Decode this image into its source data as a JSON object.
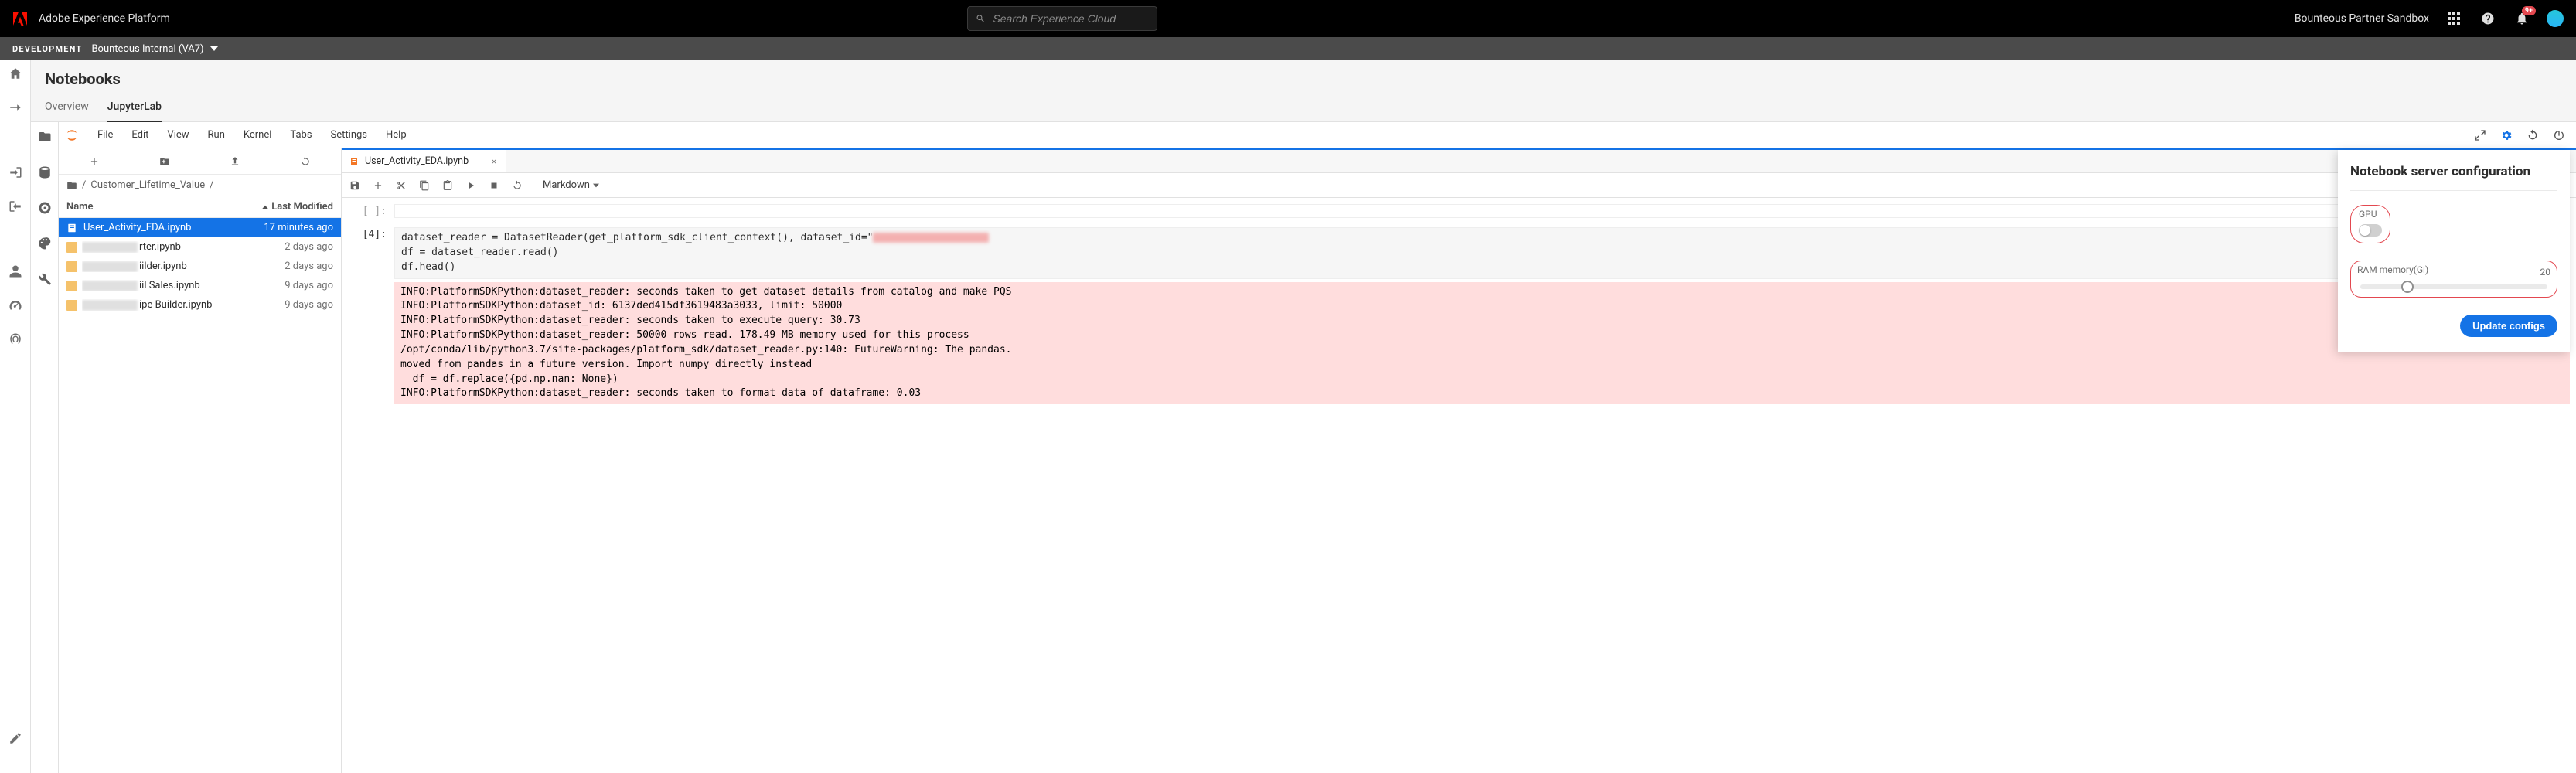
{
  "header": {
    "app_title": "Adobe Experience Platform",
    "search_placeholder": "Search Experience Cloud",
    "org_name": "Bounteous Partner Sandbox",
    "notification_badge": "9+"
  },
  "env_bar": {
    "label": "DEVELOPMENT",
    "sandbox": "Bounteous Internal (VA7)"
  },
  "page": {
    "title": "Notebooks",
    "tabs": [
      "Overview",
      "JupyterLab"
    ],
    "active_tab": "JupyterLab"
  },
  "jupyter_menu": [
    "File",
    "Edit",
    "View",
    "Run",
    "Kernel",
    "Tabs",
    "Settings",
    "Help"
  ],
  "filebrowser": {
    "crumb_segments": [
      "/",
      "Customer_Lifetime_Value",
      "/"
    ],
    "columns": {
      "name": "Name",
      "modified": "Last Modified"
    },
    "rows": [
      {
        "name": "User_Activity_EDA.ipynb",
        "modified": "17 minutes ago",
        "selected": true,
        "blurred": false
      },
      {
        "suffix": "rter.ipynb",
        "modified": "2 days ago",
        "blurred": true
      },
      {
        "suffix": "iilder.ipynb",
        "modified": "2 days ago",
        "blurred": true
      },
      {
        "suffix": "iil Sales.ipynb",
        "modified": "9 days ago",
        "blurred": true
      },
      {
        "suffix": "ipe Builder.ipynb",
        "modified": "9 days ago",
        "blurred": true
      }
    ]
  },
  "notebook": {
    "tab_name": "User_Activity_EDA.ipynb",
    "cell_type": "Markdown",
    "empty_prompt": "[ ]:",
    "exec_prompt": "[4]:",
    "code_line1": "dataset_reader = DatasetReader(get_platform_sdk_client_context(), dataset_id=\"",
    "code_line2": "df = dataset_reader.read()",
    "code_line3": "df.head()",
    "output_text": "INFO:PlatformSDKPython:dataset_reader: seconds taken to get dataset details from catalog and make PQS\nINFO:PlatformSDKPython:dataset_id: 6137ded415df3619483a3033, limit: 50000\nINFO:PlatformSDKPython:dataset_reader: seconds taken to execute query: 30.73\nINFO:PlatformSDKPython:dataset_reader: 50000 rows read. 178.49 MB memory used for this process\n/opt/conda/lib/python3.7/site-packages/platform_sdk/dataset_reader.py:140: FutureWarning: The pandas.\nmoved from pandas in a future version. Import numpy directly instead\n  df = df.replace({pd.np.nan: None})\nINFO:PlatformSDKPython:dataset_reader: seconds taken to format data of dataframe: 0.03"
  },
  "config_panel": {
    "title": "Notebook server configuration",
    "gpu_label": "GPU",
    "ram_label": "RAM memory(Gi)",
    "ram_value": "20",
    "button": "Update configs"
  }
}
